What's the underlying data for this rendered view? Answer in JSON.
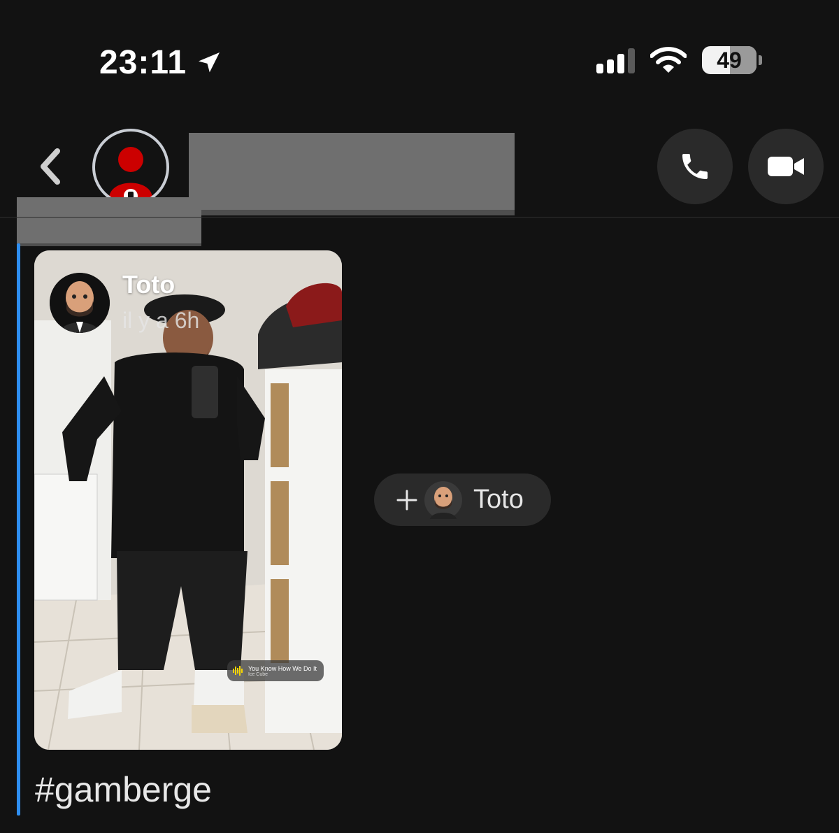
{
  "status_bar": {
    "time": "23:11",
    "battery": "49",
    "icons": [
      "location-arrow-icon",
      "signal-icon",
      "wifi-icon",
      "battery-icon"
    ]
  },
  "header": {
    "icons": [
      "back-chevron-icon",
      "avatar-icon",
      "phone-icon",
      "video-camera-icon"
    ],
    "accent_color": "#2e8ef0"
  },
  "story": {
    "user_name": "Toto",
    "time_ago": "il y a 6h",
    "music_title": "You Know How We Do It",
    "music_artist": "Ice Cube"
  },
  "caption": "#gamberge",
  "add_friend": {
    "name": "Toto",
    "icon": "plus-icon"
  }
}
